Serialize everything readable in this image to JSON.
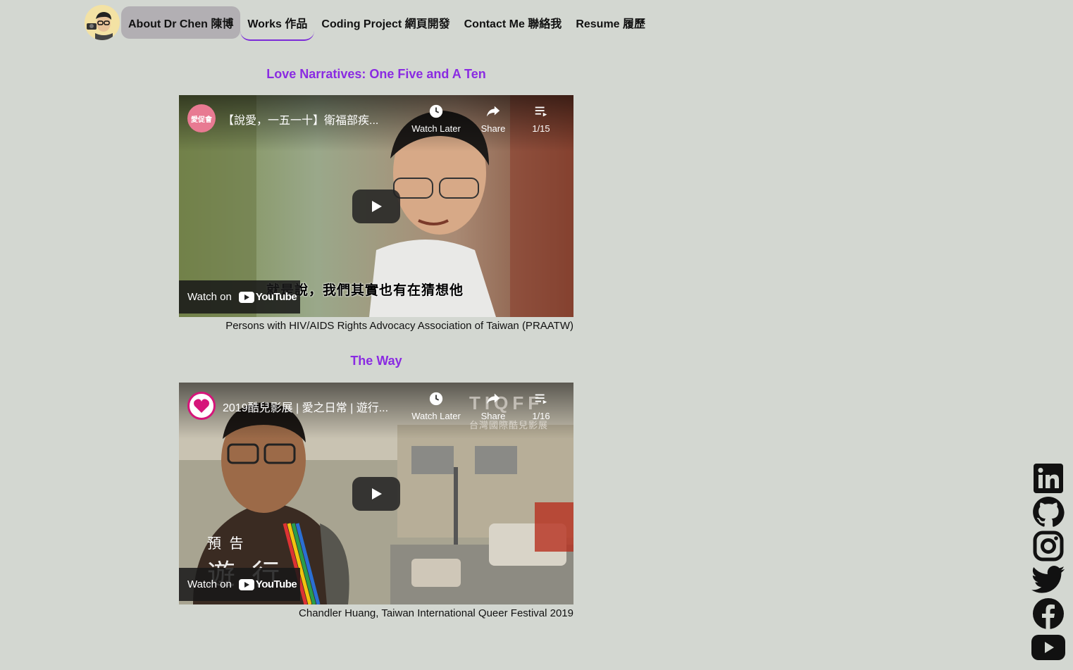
{
  "nav": {
    "about": "About Dr Chen 陳博",
    "works": "Works 作品",
    "coding": "Coding Project 網頁開發",
    "contact": "Contact Me 聯絡我",
    "resume": "Resume 履歷"
  },
  "sections": [
    {
      "title": "Love Narratives: One Five and A Ten",
      "video": {
        "channel_logo_text": "愛促會",
        "title": "【說愛，一五一十】衛福部疾...",
        "watch_later": "Watch Later",
        "share": "Share",
        "playlist": "1/15",
        "watch_on": "Watch on",
        "youtube": "YouTube",
        "subtitle": "就是說，我們其實也有在猜想他"
      },
      "caption": "Persons with HIV/AIDS Rights Advocacy Association of Taiwan (PRAATW)"
    },
    {
      "title": "The Way",
      "video": {
        "title": "2019酷兒影展 | 愛之日常 | 遊行...",
        "watch_later": "Watch Later",
        "share": "Share",
        "playlist": "1/16",
        "watch_on": "Watch on",
        "youtube": "YouTube",
        "watermark": "TIQFF",
        "watermark_sub": "台灣國際酷兒影展",
        "overlay_small": "預 告",
        "overlay_big": "遊 行"
      },
      "caption": "Chandler Huang, Taiwan International Queer Festival 2019"
    }
  ],
  "social": [
    "linkedin-icon",
    "github-icon",
    "instagram-icon",
    "twitter-icon",
    "facebook-icon",
    "youtube-icon"
  ],
  "colors": {
    "accent": "#8a2be2",
    "background": "#d3d7d1",
    "nav_active_bg": "#b2afb3"
  }
}
